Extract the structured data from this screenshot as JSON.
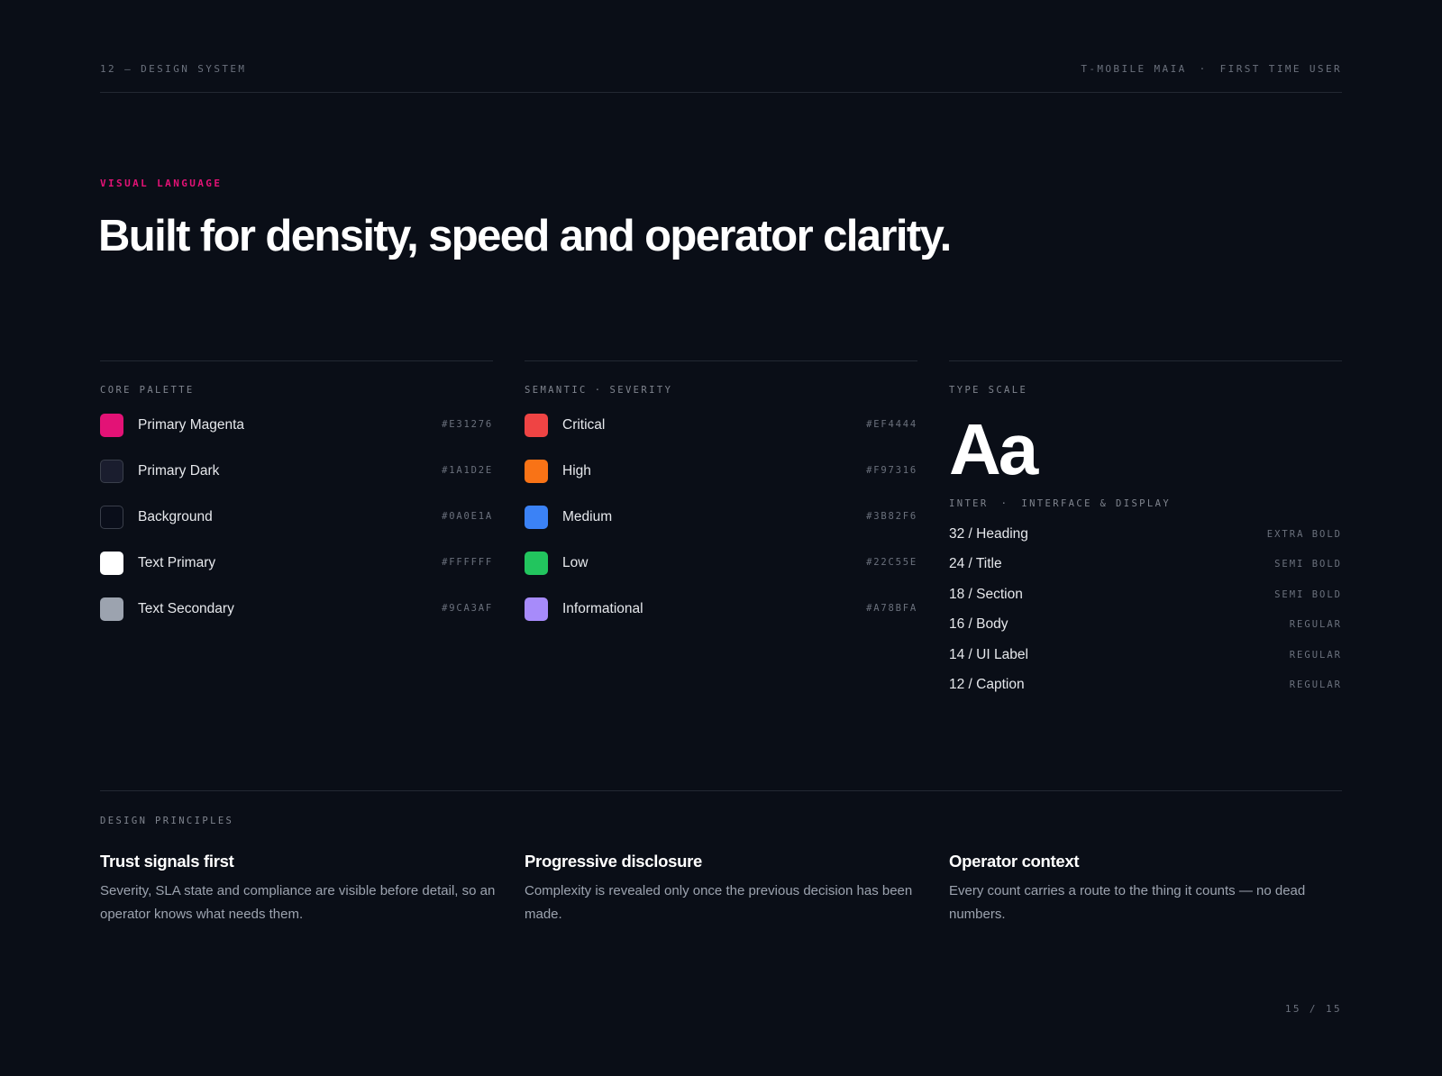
{
  "header": {
    "section": "12 — DESIGN SYSTEM",
    "product": "T-MOBILE MAIA",
    "separator": "·",
    "audience": "FIRST TIME USER"
  },
  "eyebrow": "VISUAL LANGUAGE",
  "headline": "Built for density, speed and operator clarity.",
  "core_palette": {
    "title": "CORE PALETTE",
    "items": [
      {
        "name": "Primary Magenta",
        "hex": "#E31276",
        "color": "#E31276"
      },
      {
        "name": "Primary Dark",
        "hex": "#1A1D2E",
        "color": "#1A1D2E"
      },
      {
        "name": "Background",
        "hex": "#0A0E1A",
        "color": "#0A0E1A"
      },
      {
        "name": "Text Primary",
        "hex": "#FFFFFF",
        "color": "#FFFFFF"
      },
      {
        "name": "Text Secondary",
        "hex": "#9CA3AF",
        "color": "#9CA3AF"
      }
    ]
  },
  "semantic": {
    "title_left": "SEMANTIC",
    "separator": "·",
    "title_right": "SEVERITY",
    "items": [
      {
        "name": "Critical",
        "hex": "#EF4444",
        "color": "#EF4444"
      },
      {
        "name": "High",
        "hex": "#F97316",
        "color": "#F97316"
      },
      {
        "name": "Medium",
        "hex": "#3B82F6",
        "color": "#3B82F6"
      },
      {
        "name": "Low",
        "hex": "#22C55E",
        "color": "#22C55E"
      },
      {
        "name": "Informational",
        "hex": "#A78BFA",
        "color": "#A78BFA"
      }
    ]
  },
  "type_scale": {
    "title": "TYPE SCALE",
    "sample": "Aa",
    "font_name": "INTER",
    "separator": "·",
    "font_use": "INTERFACE & DISPLAY",
    "rows": [
      {
        "label": "32 / Heading",
        "weight": "EXTRA BOLD"
      },
      {
        "label": "24 / Title",
        "weight": "SEMI BOLD"
      },
      {
        "label": "18 / Section",
        "weight": "SEMI BOLD"
      },
      {
        "label": "16 / Body",
        "weight": "REGULAR"
      },
      {
        "label": "14 / UI Label",
        "weight": "REGULAR"
      },
      {
        "label": "12 / Caption",
        "weight": "REGULAR"
      }
    ]
  },
  "principles": {
    "title": "DESIGN PRINCIPLES",
    "items": [
      {
        "heading": "Trust signals first",
        "body": "Severity, SLA state and compliance are visible before detail, so an operator knows what needs them."
      },
      {
        "heading": "Progressive disclosure",
        "body": "Complexity is revealed only once the previous decision has been made."
      },
      {
        "heading": "Operator context",
        "body": "Every count carries a route to the thing it counts — no dead numbers."
      }
    ]
  },
  "page_number": "15 / 15",
  "colors": {
    "background": "#0A0E17",
    "accent": "#E31276",
    "divider": "#232833"
  }
}
